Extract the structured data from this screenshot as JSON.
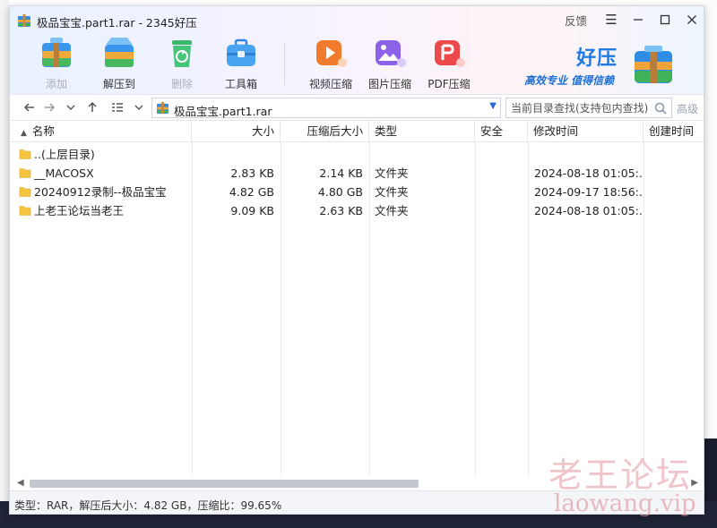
{
  "window": {
    "title": "极品宝宝.part1.rar - 2345好压",
    "feedback": "反馈"
  },
  "toolbar": {
    "items": [
      {
        "label": "添加",
        "icon": "add-box-icon",
        "disabled": true
      },
      {
        "label": "解压到",
        "icon": "extract-box-icon",
        "disabled": false
      },
      {
        "label": "删除",
        "icon": "recycle-bin-icon",
        "disabled": true
      },
      {
        "label": "工具箱",
        "icon": "toolbox-icon",
        "disabled": false
      },
      {
        "label": "视频压缩",
        "icon": "video-compress-icon",
        "disabled": false
      },
      {
        "label": "图片压缩",
        "icon": "image-compress-icon",
        "disabled": false
      },
      {
        "label": "PDF压缩",
        "icon": "pdf-compress-icon",
        "disabled": false
      }
    ]
  },
  "brand": {
    "name": "好压",
    "slogan": "高效专业  值得信赖"
  },
  "address": {
    "path": "极品宝宝.part1.rar",
    "search_placeholder": "当前目录查找(支持包内查找)",
    "advanced": "高级"
  },
  "columns": {
    "name": "名称",
    "size": "大小",
    "packed": "压缩后大小",
    "type": "类型",
    "security": "安全",
    "modified": "修改时间",
    "created": "创建时间"
  },
  "rows": [
    {
      "name": "..(上层目录)",
      "size": "",
      "packed": "",
      "type": "",
      "security": "",
      "modified": "",
      "created": ""
    },
    {
      "name": "__MACOSX",
      "size": "2.83 KB",
      "packed": "2.14 KB",
      "type": "文件夹",
      "security": "",
      "modified": "2024-08-18 01:05:...",
      "created": ""
    },
    {
      "name": "20240912录制--极品宝宝",
      "size": "4.82 GB",
      "packed": "4.80 GB",
      "type": "文件夹",
      "security": "",
      "modified": "2024-09-17 18:56:...",
      "created": ""
    },
    {
      "name": "上老王论坛当老王",
      "size": "9.09 KB",
      "packed": "2.63 KB",
      "type": "文件夹",
      "security": "",
      "modified": "2024-08-18 01:05:...",
      "created": ""
    }
  ],
  "status": {
    "text": "类型：RAR，解压后大小：4.82 GB，压缩比：99.65%"
  },
  "watermark": {
    "cn": "老王论坛",
    "en": "laowang.vip"
  },
  "colors": {
    "accent": "#1e7be6",
    "folder": "#f5c542"
  }
}
